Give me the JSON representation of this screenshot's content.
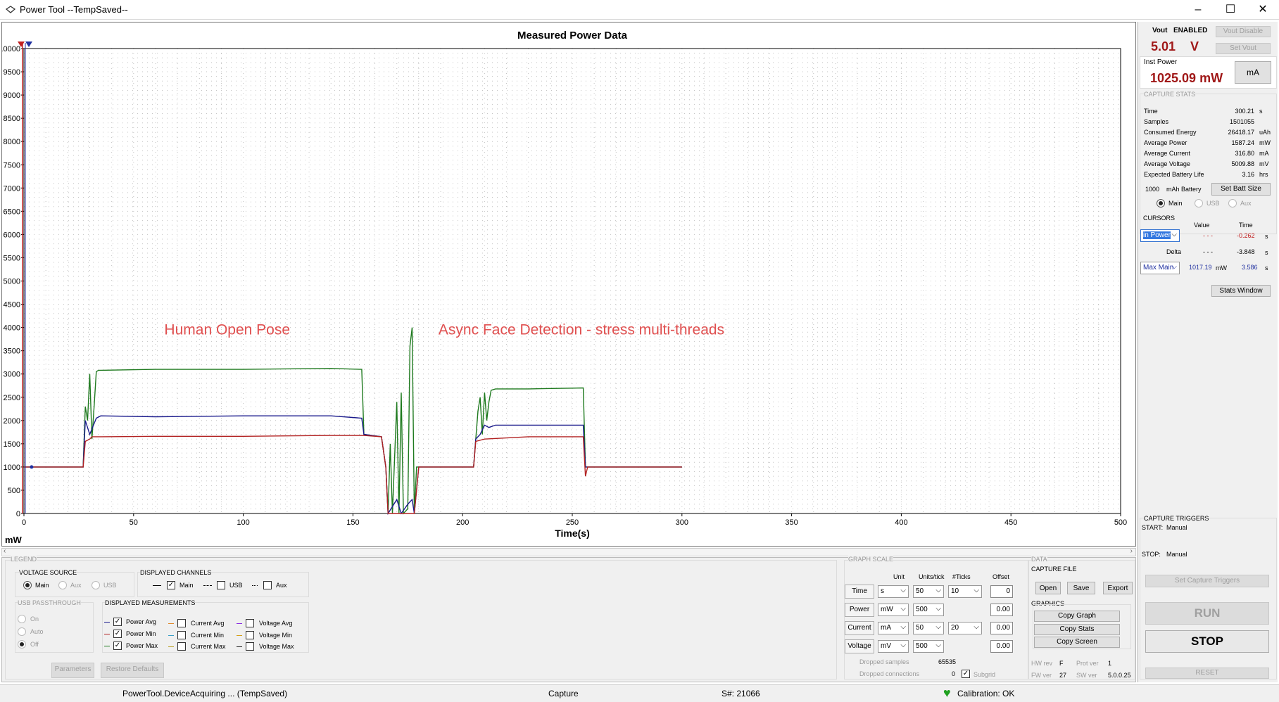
{
  "window": {
    "title": "Power Tool --TempSaved--",
    "minimize": "–",
    "maximize": "☐",
    "close": "✕"
  },
  "chart_data": {
    "type": "line",
    "title": "Measured Power Data",
    "xlabel": "Time(s)",
    "ylabel": "mW",
    "xlim": [
      0,
      500
    ],
    "ylim": [
      0,
      10000
    ],
    "x_ticks": [
      0,
      50,
      100,
      150,
      200,
      250,
      300,
      350,
      400,
      450,
      500
    ],
    "y_ticks": [
      0,
      500,
      1000,
      1500,
      2000,
      2500,
      3000,
      3500,
      4000,
      4500,
      5000,
      5500,
      6000,
      6500,
      7000,
      7500,
      8000,
      8500,
      9000,
      9500,
      10000
    ],
    "grid": true,
    "annotations": [
      "Human Open Pose",
      "Async Face Detection - stress multi-threads"
    ],
    "series": [
      {
        "name": "Power Max",
        "color": "#1f7a1f",
        "x": [
          0,
          27,
          28,
          29,
          30,
          31,
          32,
          33,
          34,
          35,
          60,
          100,
          140,
          154,
          155,
          163,
          165,
          166,
          167,
          168,
          170,
          171,
          172,
          173,
          175,
          176,
          177,
          178,
          179,
          180,
          205,
          206,
          207,
          208,
          209,
          210,
          211,
          212,
          213,
          215,
          230,
          255,
          256,
          257,
          300
        ],
        "y": [
          1000,
          1000,
          2300,
          2000,
          3000,
          1600,
          2300,
          3050,
          3080,
          3080,
          3100,
          3100,
          3120,
          3100,
          1700,
          1650,
          1000,
          0,
          1500,
          0,
          2400,
          0,
          2600,
          0,
          100,
          3600,
          4000,
          0,
          1000,
          1000,
          1000,
          1600,
          2200,
          2500,
          1700,
          2600,
          2000,
          2400,
          2650,
          2680,
          2680,
          2700,
          1000,
          1000,
          1000
        ]
      },
      {
        "name": "Power Avg",
        "color": "#1a1a8c",
        "x": [
          0,
          27,
          28,
          30,
          33,
          35,
          60,
          100,
          140,
          154,
          155,
          163,
          165,
          166,
          170,
          172,
          175,
          177,
          178,
          180,
          205,
          206,
          208,
          210,
          212,
          215,
          230,
          255,
          256,
          300
        ],
        "y": [
          1000,
          1000,
          2000,
          1700,
          2050,
          2100,
          2080,
          2100,
          2100,
          2050,
          1700,
          1650,
          1000,
          0,
          300,
          0,
          200,
          300,
          0,
          1000,
          1000,
          1600,
          1700,
          1900,
          1850,
          1900,
          1900,
          1900,
          1000,
          1000
        ]
      },
      {
        "name": "Power Min",
        "color": "#b22222",
        "x": [
          0,
          27,
          28,
          30,
          31,
          35,
          60,
          100,
          140,
          154,
          155,
          163,
          165,
          166,
          170,
          172,
          175,
          177,
          178,
          180,
          205,
          206,
          210,
          230,
          255,
          256,
          257,
          300
        ],
        "y": [
          1000,
          1000,
          1550,
          1600,
          1650,
          1650,
          1660,
          1660,
          1680,
          1680,
          1680,
          1650,
          1000,
          0,
          0,
          0,
          0,
          0,
          0,
          1000,
          1000,
          1550,
          1600,
          1650,
          1650,
          800,
          1000,
          1000
        ]
      }
    ]
  },
  "side": {
    "vout_label": "Vout",
    "vout_state": "ENABLED",
    "vout_value": "5.01",
    "vout_unit": "V",
    "vout_disable": "Vout Disable",
    "set_vout": "Set Vout",
    "inst_power_label": "Inst Power",
    "inst_power_value": "1025.09 mW",
    "ma_button": "mA",
    "capture_stats_label": "CAPTURE STATS",
    "stats": [
      {
        "label": "Time",
        "value": "300.21",
        "unit": "s"
      },
      {
        "label": "Samples",
        "value": "1501055",
        "unit": ""
      },
      {
        "label": "Consumed Energy",
        "value": "26418.17",
        "unit": "uAh"
      },
      {
        "label": "Average Power",
        "value": "1587.24",
        "unit": "mW"
      },
      {
        "label": "Average Current",
        "value": "316.80",
        "unit": "mA"
      },
      {
        "label": "Average Voltage",
        "value": "5009.88",
        "unit": "mV"
      },
      {
        "label": "Expected Battery Life",
        "value": "3.16",
        "unit": "hrs"
      }
    ],
    "battery_value": "1000",
    "battery_label": "mAh Battery",
    "set_batt_size": "Set Batt Size",
    "channel_main": "Main",
    "channel_usb": "USB",
    "channel_aux": "Aux",
    "cursors_label": "CURSORS",
    "cursors_value_header": "Value",
    "cursors_time_header": "Time",
    "cursor1_select": "in Power",
    "cursor1_value": "- - -",
    "cursor1_time": "-0.262",
    "cursor1_unit": "s",
    "delta_label": "Delta",
    "delta_value": "- - -",
    "delta_time": "-3.848",
    "delta_unit": "s",
    "cursor2_select": "Max Main",
    "cursor2_value": "1017.19",
    "cursor2_value_unit": "mW",
    "cursor2_time": "3.586",
    "cursor2_unit": "s",
    "stats_window": "Stats Window",
    "capture_triggers_label": "CAPTURE TRIGGERS",
    "start_label": "START:",
    "start_value": "Manual",
    "stop_label": "STOP:",
    "stop_value": "Manual",
    "set_capture_triggers": "Set Capture Triggers",
    "run": "RUN",
    "stop": "STOP",
    "reset": "RESET"
  },
  "legend": {
    "legend_label": "LEGEND",
    "voltage_source_label": "VOLTAGE SOURCE",
    "vs_main": "Main",
    "vs_aux": "Aux",
    "vs_usb": "USB",
    "displayed_channels_label": "DISPLAYED CHANNELS",
    "ch_main": "Main",
    "ch_usb": "USB",
    "ch_aux": "Aux",
    "usb_passthrough_label": "USB PASSTHROUGH",
    "pt_on": "On",
    "pt_auto": "Auto",
    "pt_off": "Off",
    "displayed_measurements_label": "DISPLAYED MEASUREMENTS",
    "m_power_avg": "Power Avg",
    "m_power_min": "Power Min",
    "m_power_max": "Power Max",
    "m_current_avg": "Current Avg",
    "m_current_min": "Current Min",
    "m_current_max": "Current Max",
    "m_voltage_avg": "Voltage Avg",
    "m_voltage_min": "Voltage Min",
    "m_voltage_max": "Voltage Max",
    "parameters": "Parameters",
    "restore_defaults": "Restore Defaults"
  },
  "graph_scale": {
    "label": "GRAPH SCALE",
    "unit_header": "Unit",
    "units_tick_header": "Units/tick",
    "ticks_header": "#Ticks",
    "offset_header": "Offset",
    "rows": [
      {
        "name": "Time",
        "unit": "s",
        "units_tick": "50",
        "ticks": "10",
        "offset": "0"
      },
      {
        "name": "Power",
        "unit": "mW",
        "units_tick": "500",
        "ticks": "",
        "offset": "0.00"
      },
      {
        "name": "Current",
        "unit": "mA",
        "units_tick": "50",
        "ticks": "20",
        "offset": "0.00"
      },
      {
        "name": "Voltage",
        "unit": "mV",
        "units_tick": "500",
        "ticks": "",
        "offset": "0.00"
      }
    ],
    "dropped_samples_label": "Dropped samples",
    "dropped_samples_value": "65535",
    "dropped_connections_label": "Dropped connections",
    "dropped_connections_value": "0",
    "subgrid": "Subgrid"
  },
  "data_panel": {
    "label": "DATA",
    "capture_file_label": "CAPTURE FILE",
    "open": "Open",
    "save": "Save",
    "export": "Export",
    "graphics_label": "GRAPHICS",
    "copy_graph": "Copy Graph",
    "copy_stats": "Copy Stats",
    "copy_screen": "Copy Screen",
    "hw_rev_label": "HW rev",
    "hw_rev_value": "F",
    "prot_ver_label": "Prot ver",
    "prot_ver_value": "1",
    "fw_ver_label": "FW ver",
    "fw_ver_value": "27",
    "sw_ver_label": "SW ver",
    "sw_ver_value": "5.0.0.25"
  },
  "status": {
    "device": "PowerTool.DeviceAcquiring ... (TempSaved)",
    "mode": "Capture",
    "serial": "S#: 21066",
    "calibration": "Calibration: OK",
    "heart_color": "#1fa01f"
  }
}
